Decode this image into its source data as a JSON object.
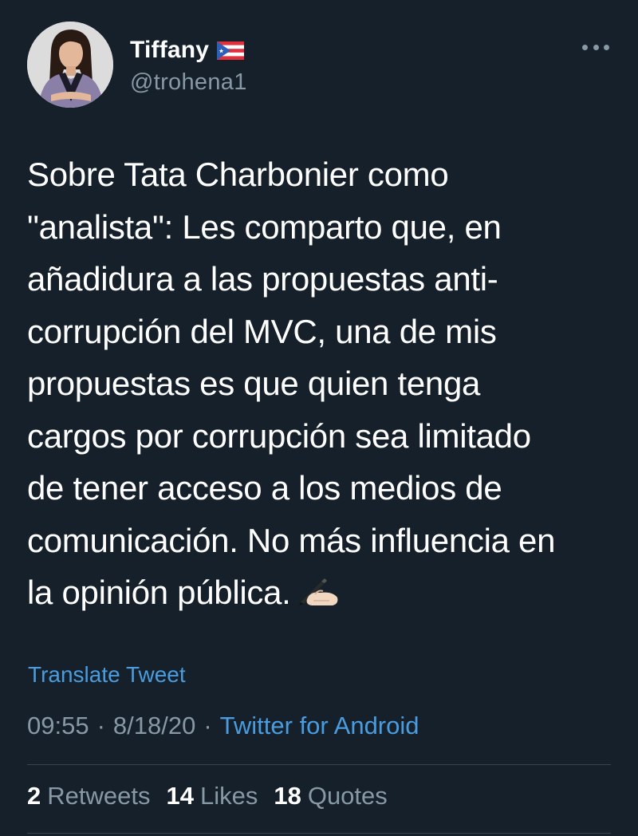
{
  "author": {
    "display_name": "Tiffany",
    "handle": "@trohena1",
    "flag_icon": "puerto-rico-flag-icon"
  },
  "tweet": {
    "lines": [
      "Sobre Tata Charbonier como",
      "\"analista\": Les comparto que, en",
      "añadidura a las propuestas anti-",
      "corrupción del MVC, una de mis",
      "propuestas es que quien tenga",
      "cargos por corrupción sea limitado",
      "de tener acceso a los medios de",
      "comunicación. No más influencia en",
      "la opinión pública."
    ],
    "trailing_emoji": "writing-hand-icon"
  },
  "translate_label": "Translate Tweet",
  "meta": {
    "time": "09:55",
    "separator": "·",
    "date": "8/18/20",
    "source": "Twitter for Android"
  },
  "stats": {
    "retweets_count": "2",
    "retweets_label": "Retweets",
    "likes_count": "14",
    "likes_label": "Likes",
    "quotes_count": "18",
    "quotes_label": "Quotes"
  },
  "colors": {
    "background": "#15202b",
    "primary_text": "#ffffff",
    "secondary_text": "#8899a6",
    "link": "#4a9cde",
    "divider": "#38444d"
  }
}
